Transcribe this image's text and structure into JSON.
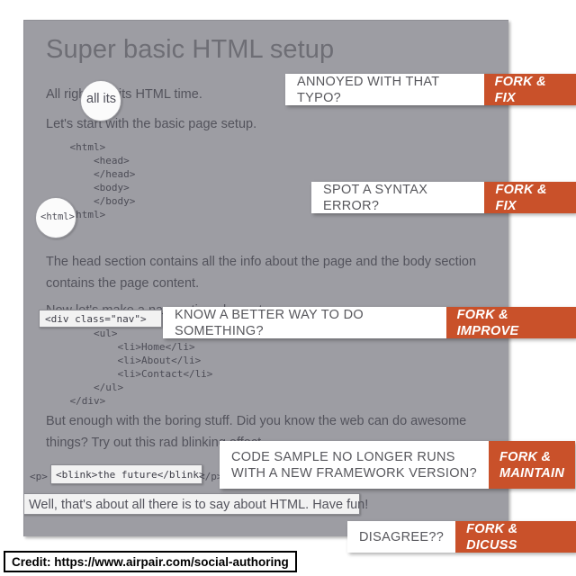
{
  "colors": {
    "panel_gray": "#9d9da3",
    "accent_orange": "#c9512a",
    "badge_question_bg": "#ffffff",
    "body_text": "#53535c",
    "title_text": "#6e6e75"
  },
  "article": {
    "title": "Super basic HTML setup",
    "paragraphs": [
      "All right y'all its HTML time.",
      "Let's start with the basic page setup.",
      "The head  section contains all the info about the page and the body section contains the page content.",
      "Now let's make a navagation element.",
      "But enough with the boring stuff. Did you know the web can do awesome things? Try out this rad blinking effect."
    ],
    "code_block_1": "    <html>\n        <head>\n        </head>\n        <body>\n        </body>",
    "code_block_1_last_line": "    <html>",
    "code_block_2_first_line": "<div class=\"nav\">",
    "code_block_2": "        <ul>\n            <li>Home</li>\n            <li>About</li>\n            <li>Contact</li>\n        </ul>\n    </div>",
    "code_block_3_prefix": "<p>",
    "code_block_3_highlight": "<blink>the future</blink>",
    "code_block_3_suffix": "</p>",
    "closing_line": "Well, that's about all there is to say about HTML. Have fun!",
    "circle_highlight_1": "all its",
    "circle_highlight_2": "<html>"
  },
  "badges": [
    {
      "question": "ANNOYED WITH THAT TYPO?",
      "action": "FORK & FIX"
    },
    {
      "question": "SPOT A SYNTAX ERROR?",
      "action": "FORK & FIX"
    },
    {
      "question": "KNOW A BETTER WAY TO DO SOMETHING?",
      "action": "FORK & IMPROVE"
    },
    {
      "question": "CODE SAMPLE NO LONGER RUNS\nWITH A NEW FRAMEWORK VERSION?",
      "action": "FORK &\nMAINTAIN"
    },
    {
      "question": "DISAGREE??",
      "action": "FORK & DICUSS"
    }
  ],
  "credit": {
    "text": "Credit: https://www.airpair.com/social-authoring"
  }
}
